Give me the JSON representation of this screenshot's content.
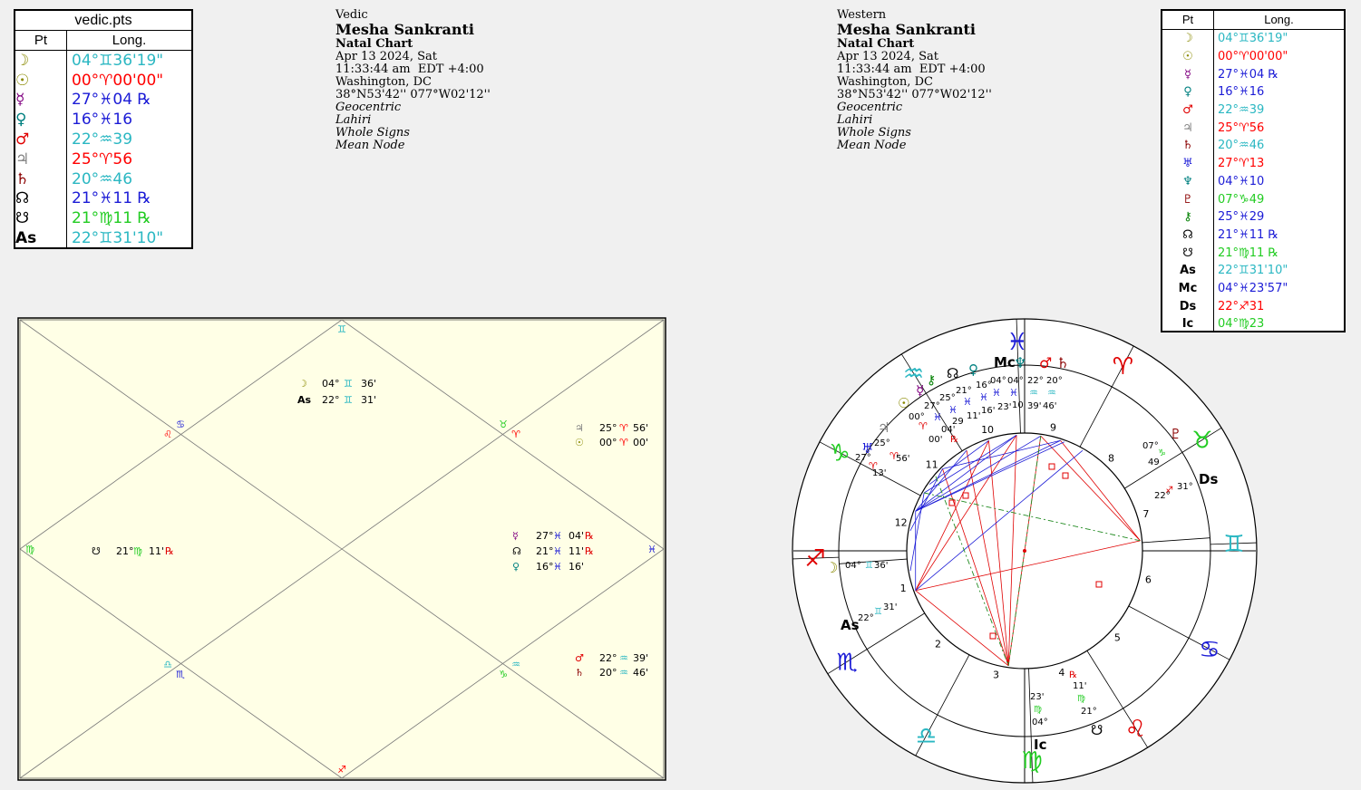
{
  "vedic_table": {
    "title": "vedic.pts",
    "col_pt": "Pt",
    "col_long": "Long.",
    "rows": [
      {
        "glyph": "☽",
        "value": "04°♊36'19\"",
        "color": "#2ab7c2",
        "glyph_color": "#8a8a00"
      },
      {
        "glyph": "☉",
        "value": "00°♈00'00\"",
        "color": "#ff0000",
        "glyph_color": "#8a8a00"
      },
      {
        "glyph": "☿",
        "value": "27°♓04 ℞",
        "color": "#1b1bd6",
        "glyph_color": "#800080"
      },
      {
        "glyph": "♀",
        "value": "16°♓16",
        "color": "#1b1bd6",
        "glyph_color": "#008080"
      },
      {
        "glyph": "♂",
        "value": "22°♒39",
        "color": "#2ab7c2",
        "glyph_color": "#e00000"
      },
      {
        "glyph": "♃",
        "value": "25°♈56",
        "color": "#ff0000",
        "glyph_color": "#808080"
      },
      {
        "glyph": "♄",
        "value": "20°♒46",
        "color": "#2ab7c2",
        "glyph_color": "#8b0000"
      },
      {
        "glyph": "☊",
        "value": "21°♓11 ℞",
        "color": "#1b1bd6",
        "glyph_color": "#000000"
      },
      {
        "glyph": "☋",
        "value": "21°♍11 ℞",
        "color": "#22cc22",
        "glyph_color": "#000000"
      },
      {
        "glyph": "As",
        "value": "22°♊31'10\"",
        "color": "#2ab7c2",
        "glyph_color": "#000000"
      }
    ]
  },
  "vedic_info": {
    "type": "Vedic",
    "name": "Mesha Sankranti",
    "chart": "Natal Chart",
    "date": "Apr 13 2024, Sat",
    "time": "11:33:44 am  EDT +4:00",
    "place": "Washington, DC",
    "coords": "38°N53'42'' 077°W02'12''",
    "line1": "Geocentric",
    "line2": "Lahiri",
    "line3": "Whole Signs",
    "line4": "Mean Node"
  },
  "western_info": {
    "type": "Western",
    "name": "Mesha Sankranti",
    "chart": "Natal Chart",
    "date": "Apr 13 2024, Sat",
    "time": "11:33:44 am  EDT +4:00",
    "place": "Washington, DC",
    "coords": "38°N53'42'' 077°W02'12''",
    "line1": "Geocentric",
    "line2": "Lahiri",
    "line3": "Whole Signs",
    "line4": "Mean Node"
  },
  "western_table": {
    "col_pt": "Pt",
    "col_long": "Long.",
    "rows": [
      {
        "glyph": "☽",
        "value": "04°♊36'19\"",
        "color": "#2ab7c2",
        "glyph_color": "#8a8a00"
      },
      {
        "glyph": "☉",
        "value": "00°♈00'00\"",
        "color": "#ff0000",
        "glyph_color": "#8a8a00"
      },
      {
        "glyph": "☿",
        "value": "27°♓04 ℞",
        "color": "#1b1bd6",
        "glyph_color": "#800080"
      },
      {
        "glyph": "♀",
        "value": "16°♓16",
        "color": "#1b1bd6",
        "glyph_color": "#008080"
      },
      {
        "glyph": "♂",
        "value": "22°♒39",
        "color": "#2ab7c2",
        "glyph_color": "#e00000"
      },
      {
        "glyph": "♃",
        "value": "25°♈56",
        "color": "#ff0000",
        "glyph_color": "#808080"
      },
      {
        "glyph": "♄",
        "value": "20°♒46",
        "color": "#2ab7c2",
        "glyph_color": "#8b0000"
      },
      {
        "glyph": "♅",
        "value": "27°♈13",
        "color": "#ff0000",
        "glyph_color": "#1b1bd6"
      },
      {
        "glyph": "♆",
        "value": "04°♓10",
        "color": "#1b1bd6",
        "glyph_color": "#008080"
      },
      {
        "glyph": "♇",
        "value": "07°♑49",
        "color": "#22cc22",
        "glyph_color": "#8b0000"
      },
      {
        "glyph": "⚷",
        "value": "25°♓29",
        "color": "#1b1bd6",
        "glyph_color": "#008000"
      },
      {
        "glyph": "☊",
        "value": "21°♓11 ℞",
        "color": "#1b1bd6",
        "glyph_color": "#000000"
      },
      {
        "glyph": "☋",
        "value": "21°♍11 ℞",
        "color": "#22cc22",
        "glyph_color": "#000000"
      },
      {
        "glyph": "As",
        "value": "22°♊31'10\"",
        "color": "#2ab7c2",
        "glyph_color": "#000000"
      },
      {
        "glyph": "Mc",
        "value": "04°♓23'57\"",
        "color": "#1b1bd6",
        "glyph_color": "#000000"
      },
      {
        "glyph": "Ds",
        "value": "22°♐31",
        "color": "#ff0000",
        "glyph_color": "#000000"
      },
      {
        "glyph": "Ic",
        "value": "04°♍23",
        "color": "#22cc22",
        "glyph_color": "#000000"
      }
    ]
  },
  "vedic_chart": {
    "house_signs": {
      "h1": "♊",
      "h2a": "♋",
      "h2b": "♌",
      "h3": "♍",
      "h4a": "♎",
      "h4b": "♏",
      "h5": "♐",
      "h6a": "♒",
      "h6b": "♑",
      "h7": "♓",
      "h8a": "♈",
      "h8b": "♉"
    },
    "planets": {
      "moon": {
        "glyph": "☽",
        "deg": "04°",
        "sign": "♊",
        "min": "36'"
      },
      "asc": {
        "glyph": "As",
        "deg": "22°",
        "sign": "♊",
        "min": "31'"
      },
      "jupiter": {
        "glyph": "♃",
        "deg": "25°",
        "sign": "♈",
        "min": "56'"
      },
      "sun": {
        "glyph": "☉",
        "deg": "00°",
        "sign": "♈",
        "min": "00'"
      },
      "ketu": {
        "glyph": "☋",
        "deg": "21°",
        "sign": "♍",
        "min": "11'",
        "retro": "℞"
      },
      "mercury": {
        "glyph": "☿",
        "deg": "27°",
        "sign": "♓",
        "min": "04'",
        "retro": "℞"
      },
      "rahu": {
        "glyph": "☊",
        "deg": "21°",
        "sign": "♓",
        "min": "11'",
        "retro": "℞"
      },
      "venus": {
        "glyph": "♀",
        "deg": "16°",
        "sign": "♓",
        "min": "16'"
      },
      "mars": {
        "glyph": "♂",
        "deg": "22°",
        "sign": "♒",
        "min": "39'"
      },
      "saturn": {
        "glyph": "♄",
        "deg": "20°",
        "sign": "♒",
        "min": "46'"
      }
    }
  },
  "western_chart": {
    "zodiac": [
      "♓",
      "♒",
      "♑",
      "♐",
      "♏",
      "♎",
      "♍",
      "♌",
      "♋",
      "♊",
      "♉",
      "♈"
    ],
    "house_numbers": [
      "1",
      "2",
      "3",
      "4",
      "5",
      "6",
      "7",
      "8",
      "9",
      "10",
      "11",
      "12"
    ],
    "angles": {
      "mc": "Mc",
      "ic": "Ic",
      "as": "As",
      "ds": "Ds"
    },
    "labels": {
      "moon_deg": "04°",
      "moon_sign": "♊",
      "moon_min": "36'",
      "as_deg": "22°",
      "as_sign": "♊",
      "as_min": "31'",
      "ds_deg": "22°",
      "ds_sign": "♐",
      "ds_min": "31°",
      "pluto_deg": "07°",
      "pluto_sign": "♑",
      "pluto_min": "49",
      "ic_deg": "04°",
      "ic_sign": "♍",
      "ic_min": "23'",
      "ketu_deg": "21°",
      "ketu_sign": "♍",
      "ketu_min": "11'",
      "ketu_retro": "℞",
      "mc_deg": "04°",
      "nept_deg": "04°",
      "mars_deg": "22°",
      "sat_deg": "20°",
      "mars_min": "39'",
      "sat_min": "46'",
      "venus_deg": "16°",
      "rahu_deg": "21°",
      "chiron_deg": "25°",
      "merc_deg": "27°",
      "sun_deg": "00°",
      "venus_min": "16'",
      "rahu_min": "11'",
      "chiron_min": "29",
      "merc_min": "04'",
      "sun_min": "00'",
      "uranus_deg": "27°",
      "uranus_min": "13'",
      "jup_deg": "25°",
      "jup_min": "56'",
      "retro": "℞",
      "nept_min": "10",
      "mc_min": "23'",
      "sun_sign": "♈",
      "jup_sign": "♈",
      "uranus_sign": "♈"
    }
  }
}
